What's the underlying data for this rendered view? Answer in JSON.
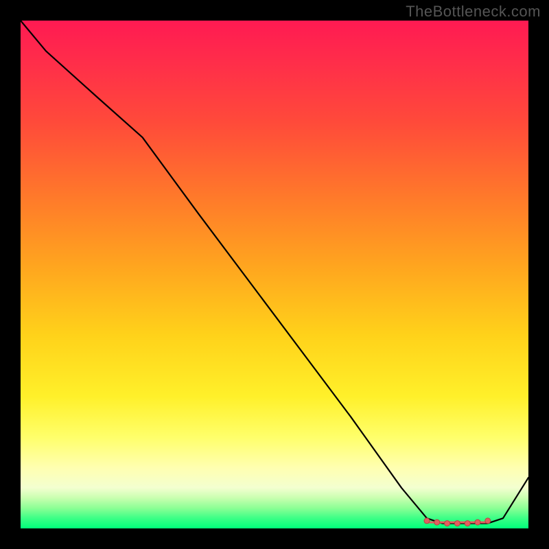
{
  "watermark": "TheBottleneck.com",
  "colors": {
    "background": "#000000",
    "line": "#000000",
    "dot_fill": "#e06060",
    "dot_stroke": "#b84040"
  },
  "chart_data": {
    "type": "line",
    "title": "",
    "xlabel": "",
    "ylabel": "",
    "xlim": [
      0,
      100
    ],
    "ylim": [
      0,
      100
    ],
    "grid": false,
    "legend": false,
    "note": "Axes unlabeled; x/y are normalized 0–100 across the plot area. y measures distance from the bottom (0 = bottom edge, 100 = top edge).",
    "series": [
      {
        "name": "curve",
        "x": [
          0,
          5,
          15,
          24,
          35,
          50,
          65,
          75,
          80,
          83,
          86,
          89,
          92,
          95,
          100
        ],
        "y": [
          100,
          94,
          85,
          77,
          62,
          42,
          22,
          8,
          2,
          1,
          1,
          1,
          1,
          2,
          10
        ]
      }
    ],
    "markers": {
      "name": "bottom-cluster",
      "x": [
        80,
        82,
        84,
        86,
        88,
        90,
        92
      ],
      "y": [
        1.5,
        1.2,
        1.0,
        1.0,
        1.0,
        1.2,
        1.5
      ]
    }
  }
}
